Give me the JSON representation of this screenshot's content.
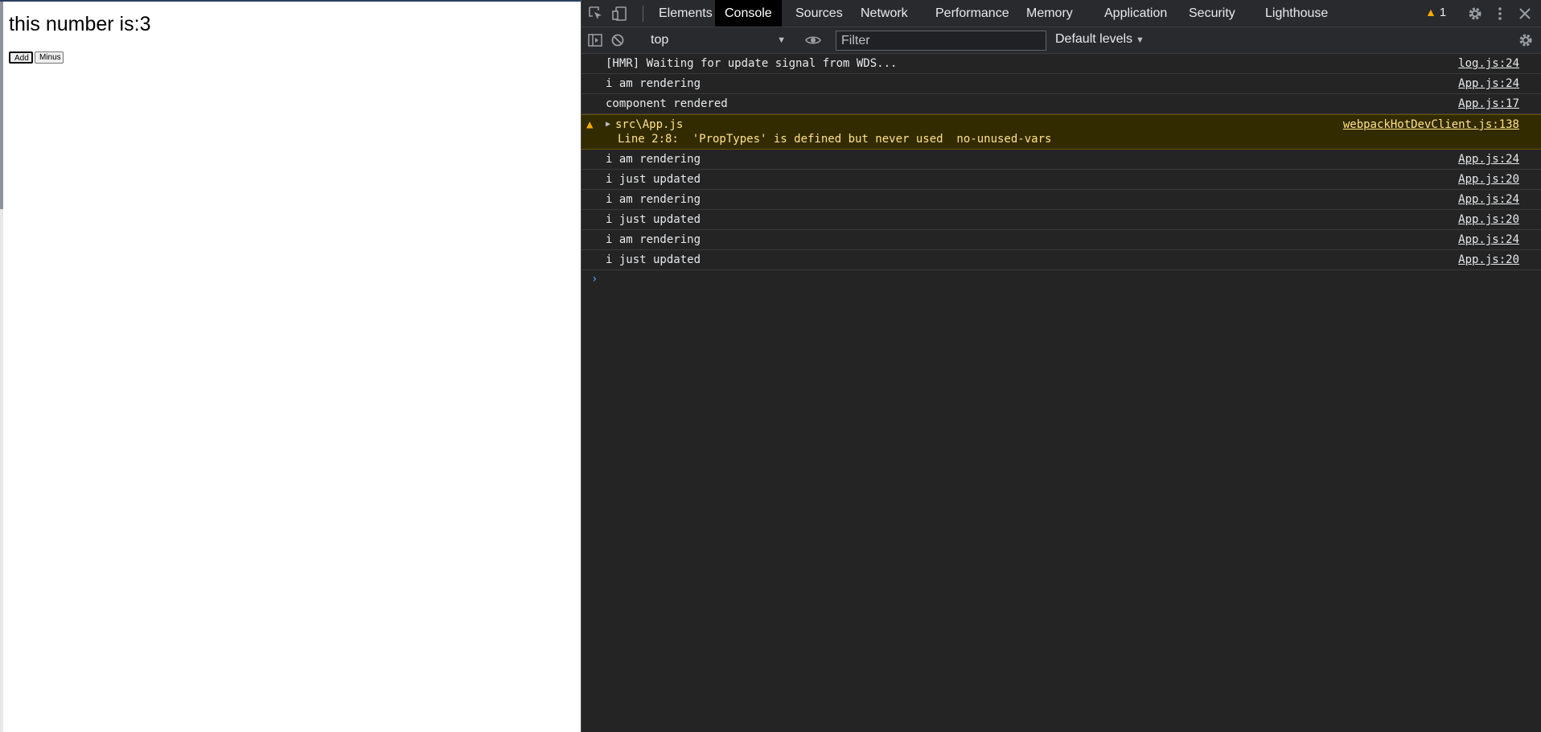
{
  "app": {
    "counter_label": "this number is:",
    "counter_value": "3",
    "add_button": "Add",
    "minus_button": "Minus"
  },
  "devtools": {
    "tabs": [
      "Elements",
      "Console",
      "Sources",
      "Network",
      "Performance",
      "Memory",
      "Application",
      "Security",
      "Lighthouse"
    ],
    "active_tab": "Console",
    "warning_count": "1",
    "context": "top",
    "filter_placeholder": "Filter",
    "levels": "Default levels",
    "messages": [
      {
        "text": "[HMR] Waiting for update signal from WDS...",
        "source": "log.js:24"
      },
      {
        "text": "i am rendering",
        "source": "App.js:24"
      },
      {
        "text": "component rendered",
        "source": "App.js:17"
      },
      {
        "type": "warning",
        "file": "src\\App.js",
        "text": "Line 2:8:  'PropTypes' is defined but never used  no-unused-vars",
        "source": "webpackHotDevClient.js:138"
      },
      {
        "text": "i am rendering",
        "source": "App.js:24"
      },
      {
        "text": "i just updated",
        "source": "App.js:20"
      },
      {
        "text": "i am rendering",
        "source": "App.js:24"
      },
      {
        "text": "i just updated",
        "source": "App.js:20"
      },
      {
        "text": "i am rendering",
        "source": "App.js:24"
      },
      {
        "text": "i just updated",
        "source": "App.js:20"
      }
    ],
    "prompt": "›",
    "colors": {
      "panel_bg": "#242424",
      "toolbar_bg": "#292a2d",
      "warning_bg": "#332b00",
      "warning_text": "#ffe38a",
      "warning_icon": "#f9ab00",
      "prompt": "#5aa7ff"
    },
    "icons": [
      "inspect-element-icon",
      "device-toolbar-icon",
      "warning-icon",
      "settings-gear-icon",
      "more-menu-icon",
      "close-icon",
      "sidebar-toggle-icon",
      "clear-console-icon",
      "live-expression-eye-icon",
      "console-settings-gear-icon"
    ]
  }
}
